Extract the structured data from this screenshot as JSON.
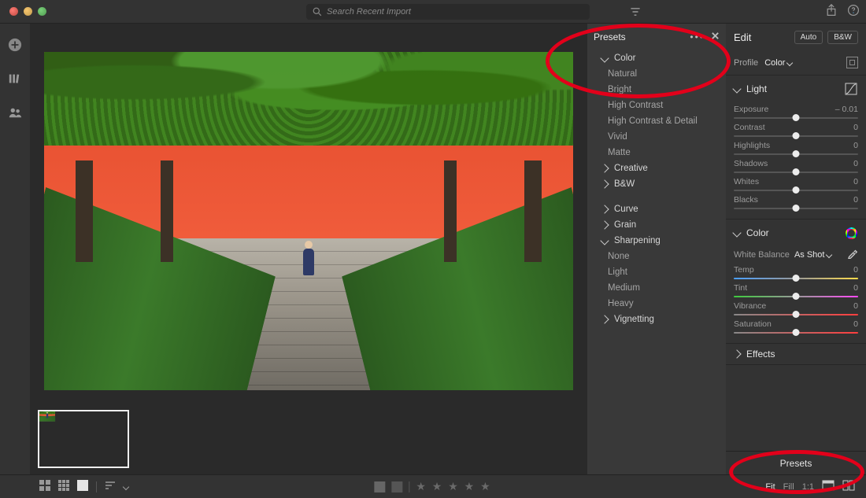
{
  "search_placeholder": "Search Recent Import",
  "presets": {
    "title": "Presets",
    "groups": {
      "color": {
        "label": "Color",
        "items": [
          "Natural",
          "Bright",
          "High Contrast",
          "High Contrast & Detail",
          "Vivid",
          "Matte"
        ]
      },
      "creative": {
        "label": "Creative"
      },
      "bw": {
        "label": "B&W"
      },
      "curve": {
        "label": "Curve"
      },
      "grain": {
        "label": "Grain"
      },
      "sharpening": {
        "label": "Sharpening",
        "items": [
          "None",
          "Light",
          "Medium",
          "Heavy"
        ]
      },
      "vignetting": {
        "label": "Vignetting"
      }
    }
  },
  "edit": {
    "title": "Edit",
    "auto": "Auto",
    "bw": "B&W",
    "profile_label": "Profile",
    "profile_value": "Color",
    "light": {
      "title": "Light",
      "exposure": {
        "label": "Exposure",
        "value": "– 0.01"
      },
      "contrast": {
        "label": "Contrast",
        "value": "0"
      },
      "highlights": {
        "label": "Highlights",
        "value": "0"
      },
      "shadows": {
        "label": "Shadows",
        "value": "0"
      },
      "whites": {
        "label": "Whites",
        "value": "0"
      },
      "blacks": {
        "label": "Blacks",
        "value": "0"
      }
    },
    "color": {
      "title": "Color",
      "wb_label": "White Balance",
      "wb_value": "As Shot",
      "temp": {
        "label": "Temp",
        "value": "0"
      },
      "tint": {
        "label": "Tint",
        "value": "0"
      },
      "vibrance": {
        "label": "Vibrance",
        "value": "0"
      },
      "saturation": {
        "label": "Saturation",
        "value": "0"
      }
    },
    "effects": {
      "title": "Effects"
    },
    "presets_button": "Presets"
  },
  "bottom": {
    "fit": "Fit",
    "fill": "Fill",
    "oneone": "1:1"
  }
}
